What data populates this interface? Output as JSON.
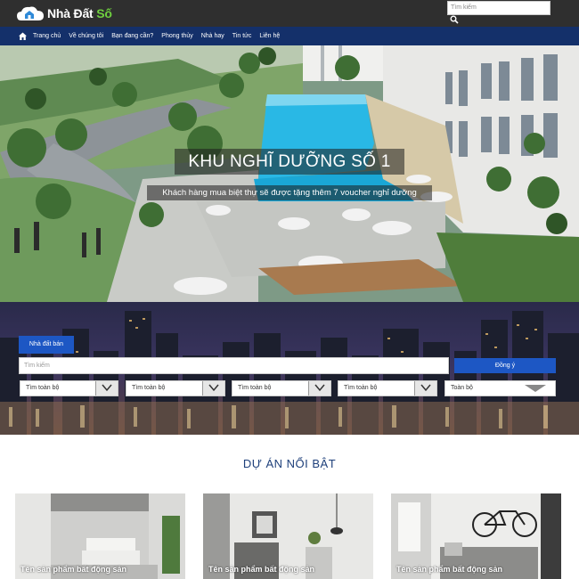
{
  "header": {
    "logo_text": "Nhà Đất",
    "logo_accent": "Số",
    "search_placeholder": "Tìm kiếm"
  },
  "nav": {
    "items": [
      {
        "label": "Trang chủ"
      },
      {
        "label": "Về chúng tôi"
      },
      {
        "label": "Bạn đang cần?"
      },
      {
        "label": "Phong thủy"
      },
      {
        "label": "Nhà hay"
      },
      {
        "label": "Tin tức"
      },
      {
        "label": "Liên hệ"
      }
    ]
  },
  "hero": {
    "title": "KHU NGHĨ DƯỠNG SỐ 1",
    "subtitle": "Khách hàng mua biệt thự sẽ được tặng thêm 7 voucher nghỉ dưỡng"
  },
  "search": {
    "tab_label": "Nhà đất bán",
    "input_placeholder": "Tìm kiếm",
    "button_label": "Đồng ý",
    "selects": [
      {
        "value": "Tìm toàn bộ"
      },
      {
        "value": "Tìm toàn bộ"
      },
      {
        "value": "Tìm toàn bộ"
      },
      {
        "value": "Tìm toàn bộ"
      },
      {
        "value": "Toàn bộ"
      }
    ]
  },
  "featured": {
    "title": "DỰ ÁN NỔI BẬT",
    "cards": [
      {
        "label": "Tên sản phẩm bất động sản"
      },
      {
        "label": "Tên sản phẩm bất động sản"
      },
      {
        "label": "Tên sản phẩm bất động sản"
      }
    ]
  },
  "colors": {
    "topbar": "#2f2f2f",
    "nav": "#14306a",
    "accent_blue": "#1d57c4",
    "logo_green": "#6fcf3f",
    "featured_title": "#1d3f7a"
  }
}
